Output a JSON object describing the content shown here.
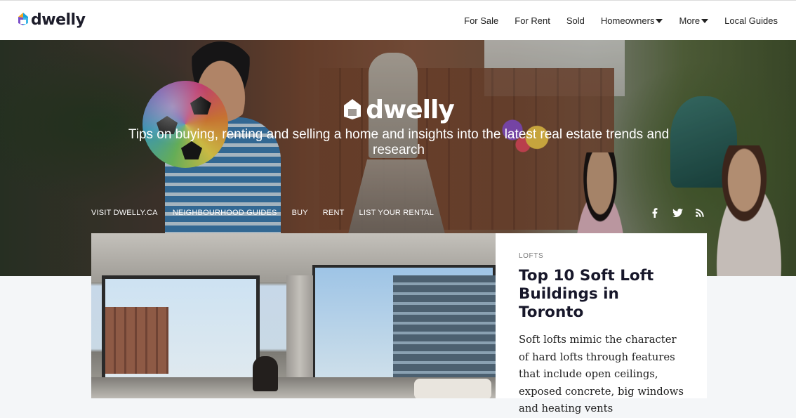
{
  "brand": {
    "name": "dwelly"
  },
  "nav": {
    "items": [
      {
        "label": "For Sale",
        "dropdown": false
      },
      {
        "label": "For Rent",
        "dropdown": false
      },
      {
        "label": "Sold",
        "dropdown": false
      },
      {
        "label": "Homeowners",
        "dropdown": true
      },
      {
        "label": "More",
        "dropdown": true
      },
      {
        "label": "Local Guides",
        "dropdown": false
      }
    ]
  },
  "hero": {
    "logo": "dwelly",
    "tagline": "Tips on buying, renting and selling a home and insights into the latest real estate trends and research",
    "links": [
      "VISIT DWELLY.CA",
      "NEIGHBOURHOOD GUIDES",
      "BUY",
      "RENT",
      "LIST YOUR RENTAL"
    ],
    "social": [
      "facebook-icon",
      "twitter-icon",
      "rss-icon"
    ]
  },
  "featured": {
    "category": "LOFTS",
    "title": "Top 10 Soft Loft Buildings in Toronto",
    "excerpt": "Soft lofts mimic the character of hard lofts through features that include open ceilings, exposed concrete, big windows and heating vents"
  },
  "colors": {
    "logo_orange": "#f5a623",
    "logo_purple": "#7b4fc9",
    "logo_blue": "#1aa3d9",
    "text_dark": "#17172a"
  }
}
